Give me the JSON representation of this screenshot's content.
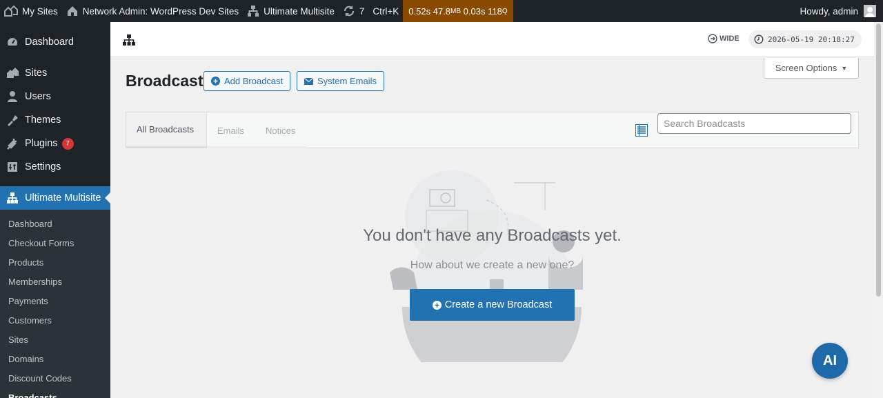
{
  "adminbar": {
    "my_sites": "My Sites",
    "network_admin": "Network Admin: WordPress Dev Sites",
    "ultimate_multisite": "Ultimate Multisite",
    "updates_count": "7",
    "shortcut": "Ctrl+K",
    "perf_time": "0.52s",
    "perf_mem": "47.8",
    "perf_mem_unit": "MB",
    "perf_query_time": "0.03s",
    "perf_queries": "118",
    "perf_queries_unit": "Q",
    "howdy": "Howdy, admin"
  },
  "sidebar": {
    "items": [
      {
        "label": "Dashboard",
        "icon": "dashboard-icon"
      },
      {
        "label": "Sites",
        "icon": "sites-icon"
      },
      {
        "label": "Users",
        "icon": "users-icon"
      },
      {
        "label": "Themes",
        "icon": "themes-icon"
      },
      {
        "label": "Plugins",
        "icon": "plugins-icon",
        "badge": "7"
      },
      {
        "label": "Settings",
        "icon": "settings-icon"
      },
      {
        "label": "Ultimate Multisite",
        "icon": "network-icon"
      }
    ],
    "submenu": [
      "Dashboard",
      "Checkout Forms",
      "Products",
      "Memberships",
      "Payments",
      "Customers",
      "Sites",
      "Domains",
      "Discount Codes",
      "Broadcasts"
    ]
  },
  "topbar": {
    "wide_label": "WIDE",
    "clock": "2026-05-19 20:18:27"
  },
  "page": {
    "screen_options": "Screen Options",
    "title": "Broadcast",
    "add_button": "Add Broadcast",
    "emails_button": "System Emails"
  },
  "tabs": [
    "All Broadcasts",
    "Emails",
    "Notices"
  ],
  "search": {
    "placeholder": "Search Broadcasts"
  },
  "empty": {
    "title": "You don't have any Broadcasts yet.",
    "subtitle": "How about we create a new one?",
    "button": "Create a new Broadcast"
  },
  "fab": {
    "label": "AI"
  },
  "colors": {
    "accent": "#2271b1",
    "adminbar": "#1d2327",
    "perf": "#8a4a00",
    "badge": "#d63638"
  }
}
